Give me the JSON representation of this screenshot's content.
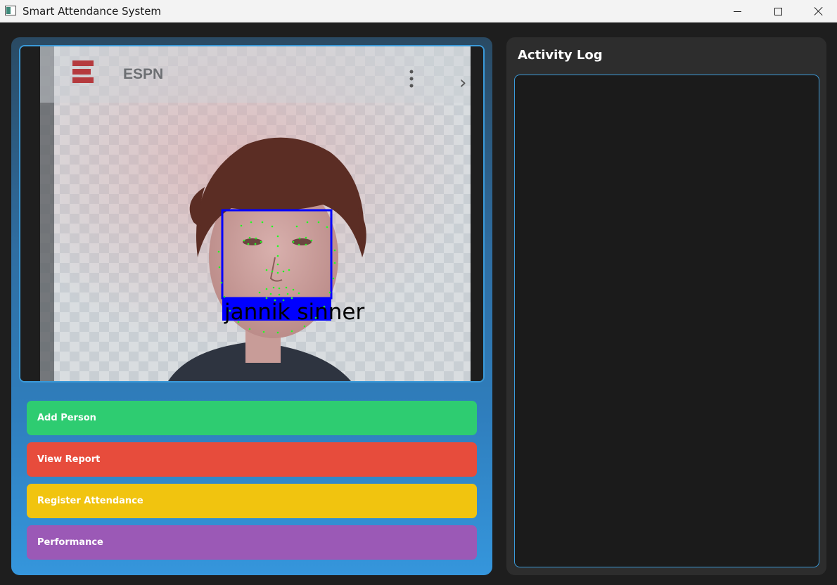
{
  "window": {
    "title": "Smart Attendance System",
    "controls": [
      "minimize",
      "maximize",
      "close"
    ]
  },
  "camera": {
    "overlay_brand": "ESPN",
    "recognized_name": "jannik sinner",
    "box_color": "#0000ff",
    "landmark_color": "#22ff22"
  },
  "actions": {
    "add_person": "Add Person",
    "view_report": "View Report",
    "register_attendance": "Register Attendance",
    "performance": "Performance"
  },
  "colors": {
    "add_person": "#2ecc71",
    "view_report": "#e74c3c",
    "register_attendance": "#f1c40f",
    "performance": "#9b59b6",
    "accent": "#3a9ad9"
  },
  "activity_log": {
    "title": "Activity Log",
    "entries": []
  }
}
